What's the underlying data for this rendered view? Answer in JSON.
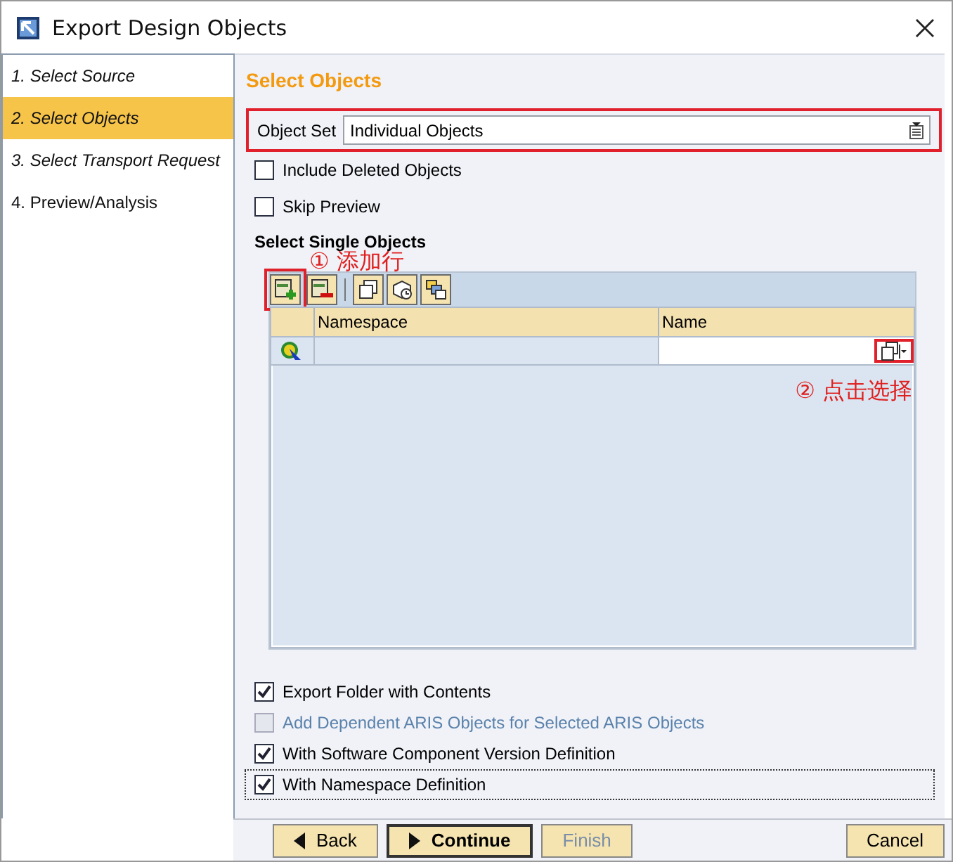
{
  "window": {
    "title": "Export Design Objects"
  },
  "steps": [
    {
      "label": "1. Select Source",
      "selected": false,
      "visited": true
    },
    {
      "label": "2. Select Objects",
      "selected": true,
      "visited": true
    },
    {
      "label": "3. Select Transport Request",
      "selected": false,
      "visited": true
    },
    {
      "label": "4. Preview/Analysis",
      "selected": false,
      "visited": false
    }
  ],
  "heading": "Select Objects",
  "object_set": {
    "label": "Object Set",
    "value": "Individual Objects",
    "highlighted": true
  },
  "top_options": [
    {
      "label": "Include Deleted Objects",
      "checked": false
    },
    {
      "label": "Skip Preview",
      "checked": false
    }
  ],
  "section_title": "Select Single Objects",
  "table": {
    "add_row_highlighted": true,
    "columns": [
      "Namespace",
      "Name"
    ],
    "value_help_highlighted": true
  },
  "annotations": [
    {
      "text": "① 添加行"
    },
    {
      "text": "② 点击选择"
    }
  ],
  "bottom_options": [
    {
      "label": "Export Folder with Contents",
      "checked": true,
      "disabled": false,
      "focused": false
    },
    {
      "label": "Add Dependent ARIS Objects for Selected ARIS Objects",
      "checked": false,
      "disabled": true,
      "focused": false
    },
    {
      "label": "With Software Component Version Definition",
      "checked": true,
      "disabled": false,
      "focused": false
    },
    {
      "label": "With Namespace Definition",
      "checked": true,
      "disabled": false,
      "focused": true
    }
  ],
  "buttons": [
    {
      "label": "Back",
      "kind": "back",
      "disabled": false
    },
    {
      "label": "Continue",
      "kind": "next",
      "disabled": false
    },
    {
      "label": "Finish",
      "kind": "plain",
      "disabled": true
    },
    {
      "label": "Cancel",
      "kind": "plain",
      "disabled": false
    }
  ]
}
